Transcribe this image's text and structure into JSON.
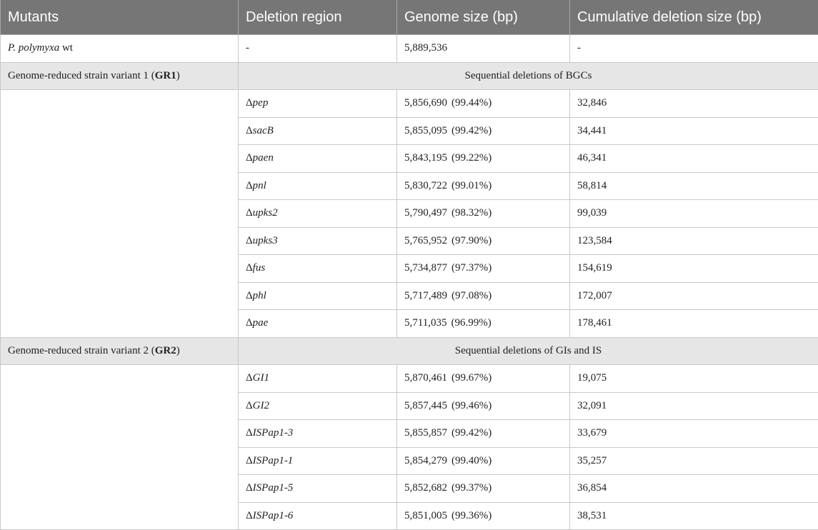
{
  "table": {
    "headers": [
      "Mutants",
      "Deletion region",
      "Genome size (bp)",
      "Cumulative deletion size (bp)"
    ],
    "wt": {
      "mutant_italic": "P. polymyxa",
      "mutant_rest": " wt",
      "region": "-",
      "genome_size": "5,889,536",
      "cumulative": "-"
    },
    "groups": [
      {
        "label_prefix": "Genome-reduced strain variant 1 (",
        "label_bold": "GR1",
        "label_suffix": ")",
        "description": "Sequential deletions of BGCs",
        "rows": [
          {
            "delta": "Δ",
            "gene": "pep",
            "size": "5,856,690",
            "pct": "(99.44%)",
            "cumulative": "32,846"
          },
          {
            "delta": "Δ",
            "gene": "sacB",
            "size": "5,855,095",
            "pct": "(99.42%)",
            "cumulative": "34,441"
          },
          {
            "delta": "Δ",
            "gene": "paen",
            "size": "5,843,195",
            "pct": "(99.22%)",
            "cumulative": "46,341"
          },
          {
            "delta": "Δ",
            "gene": "pnl",
            "size": "5,830,722",
            "pct": "(99.01%)",
            "cumulative": "58,814"
          },
          {
            "delta": "Δ",
            "gene": "upks2",
            "size": "5,790,497",
            "pct": "(98.32%)",
            "cumulative": "99,039"
          },
          {
            "delta": "Δ",
            "gene": "upks3",
            "size": "5,765,952",
            "pct": "(97.90%)",
            "cumulative": "123,584"
          },
          {
            "delta": "Δ",
            "gene": "fus",
            "size": "5,734,877",
            "pct": "(97.37%)",
            "cumulative": "154,619"
          },
          {
            "delta": "Δ",
            "gene": "phl",
            "size": "5,717,489",
            "pct": "(97.08%)",
            "cumulative": "172,007"
          },
          {
            "delta": "Δ",
            "gene": "pae",
            "size": "5,711,035",
            "pct": "(96.99%)",
            "cumulative": "178,461"
          }
        ]
      },
      {
        "label_prefix": "Genome-reduced strain variant 2 (",
        "label_bold": "GR2",
        "label_suffix": ")",
        "description": "Sequential deletions of GIs and IS",
        "rows": [
          {
            "delta": "Δ",
            "gene": "GI1",
            "size": "5,870,461",
            "pct": "(99.67%)",
            "cumulative": "19,075"
          },
          {
            "delta": "Δ",
            "gene": "GI2",
            "size": "5,857,445",
            "pct": "(99.46%)",
            "cumulative": "32,091"
          },
          {
            "delta": "Δ",
            "gene": "ISPap1-3",
            "size": "5,855,857",
            "pct": "(99.42%)",
            "cumulative": "33,679"
          },
          {
            "delta": "Δ",
            "gene": "ISPap1-1",
            "size": "5,854,279",
            "pct": "(99.40%)",
            "cumulative": "35,257"
          },
          {
            "delta": "Δ",
            "gene": "ISPap1-5",
            "size": "5,852,682",
            "pct": "(99.37%)",
            "cumulative": "36,854"
          },
          {
            "delta": "Δ",
            "gene": "ISPap1-6",
            "size": "5,851,005",
            "pct": "(99.36%)",
            "cumulative": "38,531"
          }
        ]
      }
    ]
  }
}
